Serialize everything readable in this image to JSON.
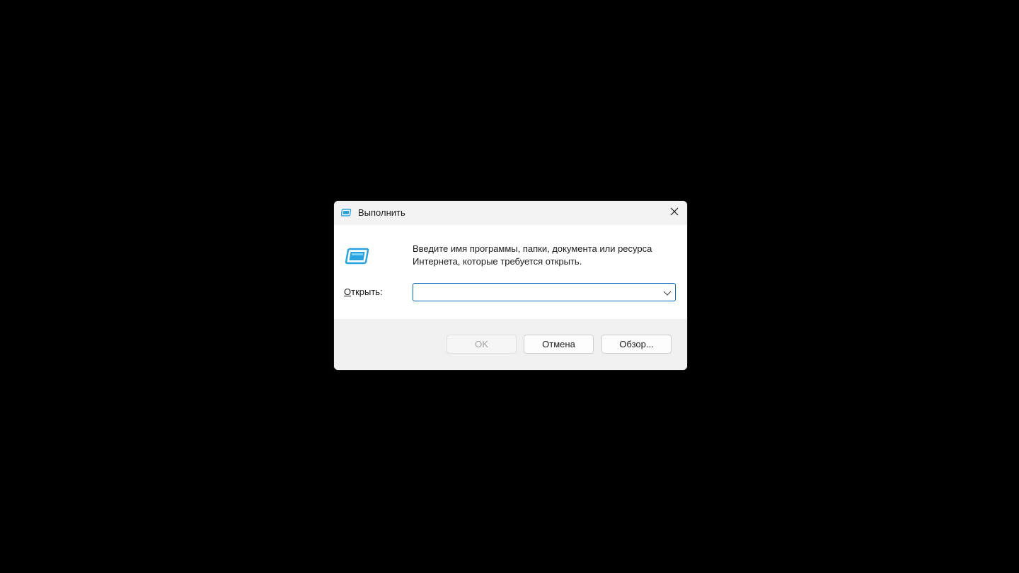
{
  "dialog": {
    "title": "Выполнить",
    "icon": "run-icon",
    "description": "Введите имя программы, папки, документа или ресурса Интернета, которые требуется открыть.",
    "open_label_mnemonic": "О",
    "open_label_rest": "ткрыть:",
    "input_value": "",
    "buttons": {
      "ok": "OK",
      "cancel": "Отмена",
      "browse": "Обзор..."
    }
  },
  "colors": {
    "background": "#000000",
    "focus_border": "#0067c0",
    "icon_accent": "#29a3e0"
  }
}
